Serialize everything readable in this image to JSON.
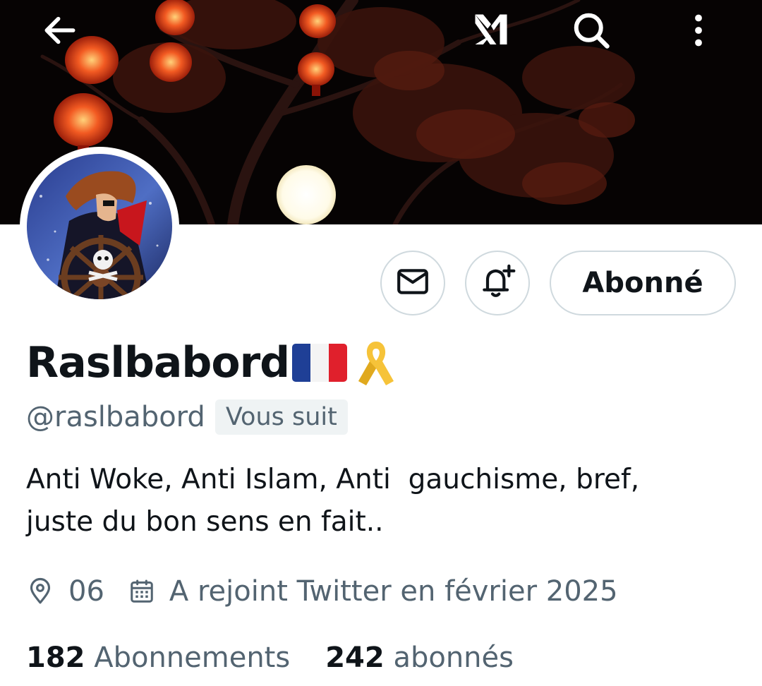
{
  "header": {
    "back_icon": "arrow-left-icon",
    "grok_icon": "grok-icon",
    "search_icon": "search-icon",
    "more_icon": "more-vertical-icon"
  },
  "profile": {
    "display_name": "Raslbabord",
    "name_emojis": "🇫🇷🎗️",
    "handle": "@raslbabord",
    "follows_you_label": "Vous suit",
    "bio_line1": "Anti Woke, Anti Islam, Anti  gauchisme, bref,",
    "bio_line2": "juste du bon sens en fait..",
    "location": "06",
    "joined": "A rejoint Twitter en février 2025",
    "following_count": "182",
    "following_label": "Abonnements",
    "followers_count": "242",
    "followers_label": "abonnés"
  },
  "actions": {
    "message_icon": "envelope-icon",
    "notify_icon": "bell-plus-icon",
    "follow_label": "Abonné"
  },
  "colors": {
    "text_primary": "#0f1419",
    "text_secondary": "#536471",
    "border": "#cfd9de",
    "badge_bg": "#eff3f4",
    "lantern": "#e8391a",
    "ribbon": "#f6c339"
  }
}
